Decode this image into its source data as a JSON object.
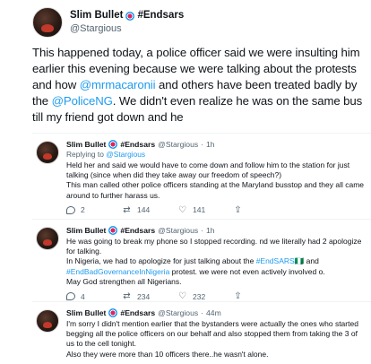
{
  "main_tweet": {
    "display_name": "Slim Bullet",
    "name_suffix": "#Endsars",
    "handle": "@Stargious",
    "text_parts": [
      {
        "t": "This happened today, a police officer said we were insulting him earlier this evening because we were talking about the protests and how ",
        "link": false
      },
      {
        "t": "@mrmacaronii",
        "link": true
      },
      {
        "t": " and others have been treated badly by the ",
        "link": false
      },
      {
        "t": "@PoliceNG",
        "link": true
      },
      {
        "t": ". We didn't even realize he was on the same bus till my friend got down and he",
        "link": false
      }
    ]
  },
  "replies": [
    {
      "display_name": "Slim Bullet",
      "name_suffix": "#Endsars",
      "handle": "@Stargious",
      "time": "1h",
      "replying_label": "Replying to",
      "replying_handle": "@Stargious",
      "text": "Held her and said we would have to come down and follow him to the station for just talking (since when did they take away our freedom of speech?)\nThis man called other police officers standing at the Maryland busstop and they all came around to further harass us.",
      "text_parts": [],
      "counts": {
        "reply": "2",
        "retweet": "144",
        "like": "141"
      }
    },
    {
      "display_name": "Slim Bullet",
      "name_suffix": "#Endsars",
      "handle": "@Stargious",
      "time": "1h",
      "text_parts": [
        {
          "t": "He was going to break my phone so I stopped recording. nd we literally had 2 apologize for talking.\nIn Nigeria, we had to apologize for just talking about the ",
          "link": false
        },
        {
          "t": "#EndSARS",
          "link": true
        },
        {
          "t": "🇳🇬 and ",
          "link": false
        },
        {
          "t": "#EndBadGovernanceInNigeria",
          "link": true
        },
        {
          "t": " protest. we were not even actively involved o.\nMay God strengthen all Nigerians.",
          "link": false
        }
      ],
      "counts": {
        "reply": "4",
        "retweet": "234",
        "like": "232"
      }
    },
    {
      "display_name": "Slim Bullet",
      "name_suffix": "#Endsars",
      "handle": "@Stargious",
      "time": "44m",
      "text": "I'm sorry I didn't mention earlier that the bystanders were actually the ones who started begging all the police officers on our behalf and also stopped them from taking the 3 of us to the cell tonight.\nAlso they were more than 10 officers there..he wasn't alone.",
      "text_parts": []
    }
  ]
}
